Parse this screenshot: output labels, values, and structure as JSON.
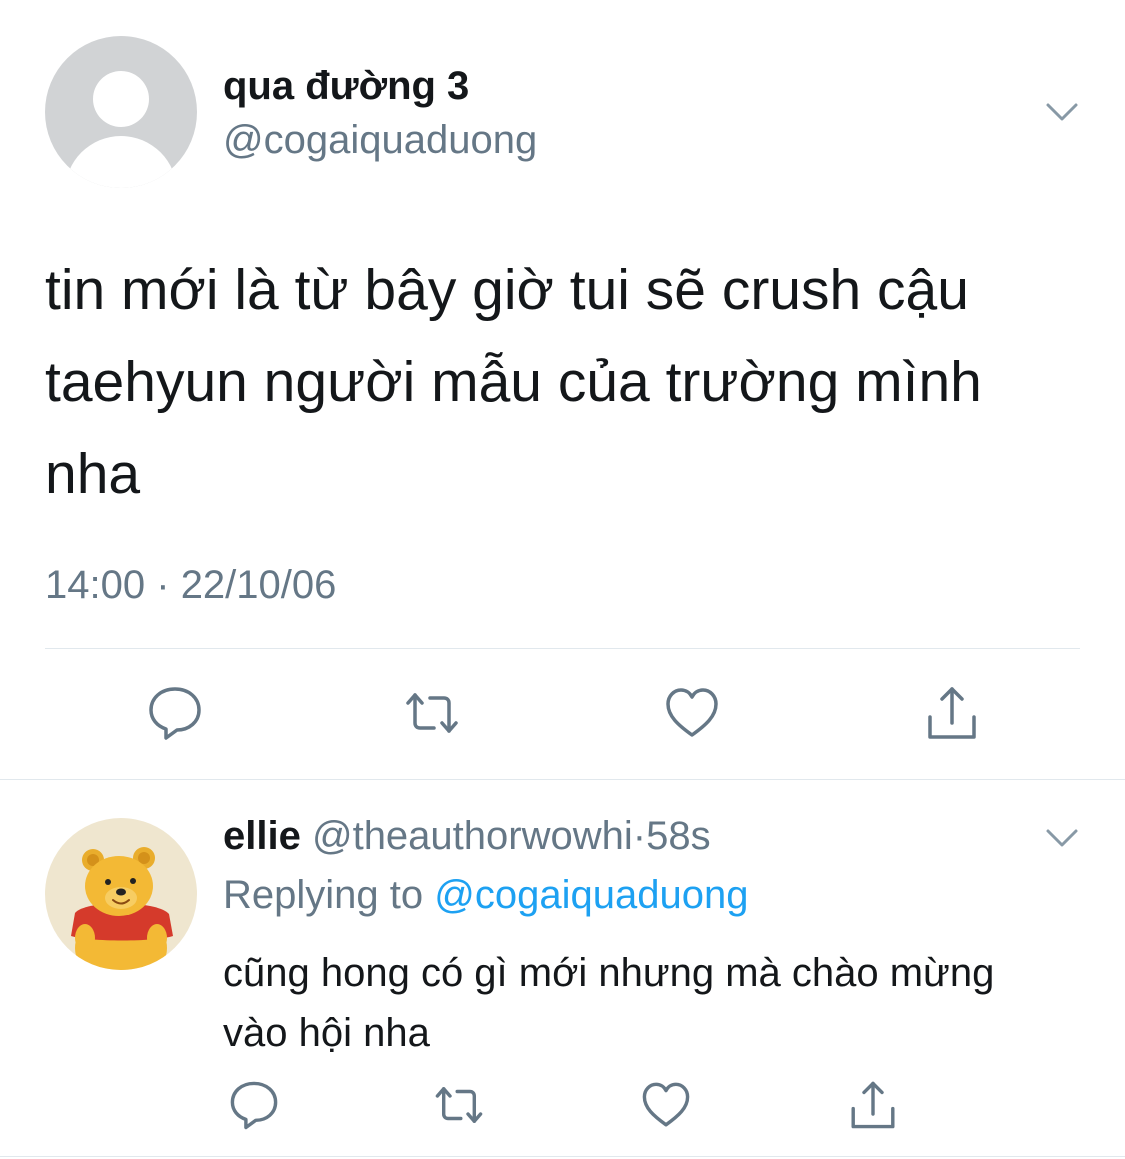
{
  "tweet": {
    "display_name": "qua đường 3",
    "handle": "@cogaiquaduong",
    "text": "tin mới là từ bây giờ tui sẽ crush cậu taehyun người mẫu của trường mình nha",
    "time": "14:00",
    "separator": "·",
    "date": "22/10/06",
    "icons": [
      "chevron-down-icon",
      "reply-icon",
      "retweet-icon",
      "like-icon",
      "share-icon"
    ]
  },
  "reply": {
    "display_name": "ellie",
    "handle": "@theauthorwowhi",
    "separator": "·",
    "time": "58s",
    "replying_prefix": "Replying to",
    "replying_handle": "@cogaiquaduong",
    "text": "cũng hong có gì mới nhưng mà chào mừng vào hội nha",
    "avatar": "winnie-the-pooh-avatar"
  },
  "colors": {
    "text_primary": "#14171a",
    "text_secondary": "#657786",
    "link": "#1da1f2",
    "divider": "#e1e8ed"
  }
}
